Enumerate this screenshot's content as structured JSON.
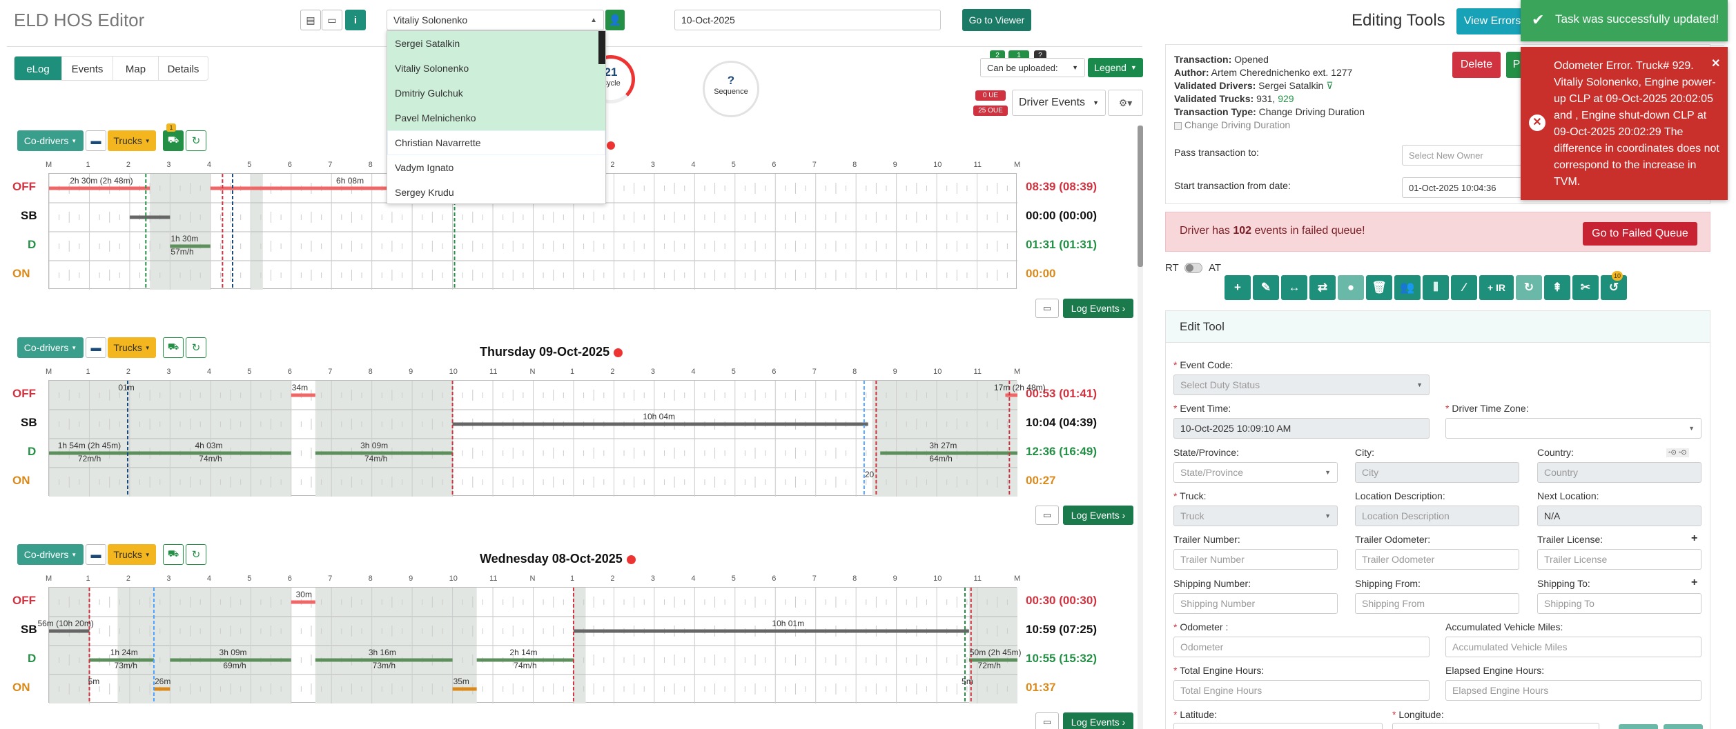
{
  "app": {
    "title": "ELD HOS Editor"
  },
  "header": {
    "driver_select": "Vitaliy Solonenko",
    "date": "10-Oct-2025",
    "go_viewer": "Go to Viewer"
  },
  "tabs": [
    {
      "label": "eLog"
    },
    {
      "label": "Events"
    },
    {
      "label": "Map"
    },
    {
      "label": "Details"
    }
  ],
  "dropdown": {
    "items": [
      "Sergei Satalkin",
      "Vitaliy Solonenko",
      "Dmitriy Gulchuk",
      "Pavel Melnichenko",
      "Christian Navarrette",
      "Vadym Ignato",
      "Sergey Krudu"
    ]
  },
  "circles": {
    "cycle_value": "21",
    "cycle_label": "Cycle",
    "seq_value": "?",
    "seq_label": "Sequence"
  },
  "upload": {
    "badge1": "2",
    "badge2": "1",
    "badge3": "?",
    "can_upload": "Can be uploaded:",
    "legend": "Legend",
    "ue": "0 UE",
    "oue": "25 OUE",
    "driver_events": "Driver Events"
  },
  "day_toolbar": {
    "codrivers": "Co-drivers",
    "trucks": "Trucks",
    "trucks_badge": "1",
    "log_events": "Log Events"
  },
  "hour_labels": [
    "M",
    "1",
    "2",
    "3",
    "4",
    "5",
    "6",
    "7",
    "8",
    "9",
    "10",
    "11",
    "N",
    "1",
    "2",
    "3",
    "4",
    "5",
    "6",
    "7",
    "8",
    "9",
    "10",
    "11",
    "M"
  ],
  "status_labels": {
    "off": "OFF",
    "sb": "SB",
    "d": "D",
    "on": "ON"
  },
  "days": [
    {
      "title": "",
      "totals": {
        "off": "08:39 (08:39)",
        "sb": "00:00 (00:00)",
        "d": "01:31 (01:31)",
        "on": "00:00"
      },
      "labels": {
        "l1": "2h 30m (2h 48m)",
        "l2": "6h 08m",
        "l3": "1h 30m",
        "l4": "57m/h"
      }
    },
    {
      "title": "Thursday 09-Oct-2025",
      "totals": {
        "off": "00:53 (01:41)",
        "sb": "10:04 (04:39)",
        "d": "12:36 (16:49)",
        "on": "00:27"
      },
      "labels": {
        "l1": "01m",
        "l2": "34m",
        "l3": "17m (2h 48m)",
        "l4": "10h 04m",
        "l5": "1h 54m (2h 45m)",
        "l6": "72m/h",
        "l7": "4h 03m",
        "l8": "74m/h",
        "l9": "3h 09m",
        "l10": "74m/h",
        "l11": "3h 27m",
        "l12": "64m/h",
        "l13": "20"
      }
    },
    {
      "title": "Wednesday 08-Oct-2025",
      "totals": {
        "off": "00:30 (00:30)",
        "sb": "10:59 (07:25)",
        "d": "10:55 (15:32)",
        "on": "01:37"
      },
      "labels": {
        "l1": "30m",
        "l2": "56m (10h 20m)",
        "l3": "10h 01m",
        "l4": "1h 24m",
        "l5": "73m/h",
        "l6": "3h 09m",
        "l7": "69m/h",
        "l8": "3h 16m",
        "l9": "73m/h",
        "l10": "2h 14m",
        "l11": "74m/h",
        "l12": "50m (2h 45m)",
        "l13": "72m/h",
        "l14": "5m",
        "l15": "26m",
        "l16": "35m",
        "l17": "5m"
      }
    }
  ],
  "editing": {
    "title": "Editing Tools",
    "view_errors": "View Errors",
    "transaction_label": "Transaction:",
    "transaction": "Opened",
    "author_label": "Author:",
    "author": "Artem Cherednichenko ext. 1277",
    "val_drivers_label": "Validated Drivers:",
    "val_drivers": "Sergei Satalkin",
    "val_trucks_label": "Validated Trucks:",
    "val_trucks_a": "931,",
    "val_trucks_b": "929",
    "ttype_label": "Transaction Type:",
    "ttype": "Change Driving Duration",
    "checkbox": "Change Driving Duration",
    "delete": "Delete",
    "p": "P",
    "pass_to": "Pass transaction to:",
    "owner_ph": "Select New Owner",
    "start_from": "Start transaction from date:",
    "start_date": "01-Oct-2025 10:04:36",
    "failed_pre": "Driver has ",
    "failed_num": "102",
    "failed_post": " events in failed queue!",
    "go_failed": "Go to Failed Queue",
    "rt": "RT",
    "at": "AT",
    "ir": "+ IR",
    "badge10": "10"
  },
  "edit_tool": {
    "title": "Edit Tool",
    "event_code": "Event Code:",
    "event_code_ph": "Select Duty Status",
    "event_time": "Event Time:",
    "event_time_val": "10-Oct-2025 10:09:10 AM",
    "driver_tz": "Driver Time Zone:",
    "state": "State/Province:",
    "state_ph": "State/Province",
    "city": "City:",
    "city_ph": "City",
    "country": "Country:",
    "country_ph": "Country",
    "truck": "Truck:",
    "truck_ph": "Truck",
    "loc_desc": "Location Description:",
    "loc_desc_ph": "Location Description",
    "next_loc": "Next Location:",
    "next_loc_val": "N/A",
    "trailer_num": "Trailer Number:",
    "trailer_num_ph": "Trailer Number",
    "trailer_odo": "Trailer Odometer:",
    "trailer_odo_ph": "Trailer Odometer",
    "trailer_lic": "Trailer License:",
    "trailer_lic_ph": "Trailer License",
    "ship_num": "Shipping Number:",
    "ship_num_ph": "Shipping Number",
    "ship_from": "Shipping From:",
    "ship_from_ph": "Shipping From",
    "ship_to": "Shipping To:",
    "ship_to_ph": "Shipping To",
    "odometer": "Odometer :",
    "odometer_ph": "Odometer",
    "acc_miles": "Accumulated Vehicle Miles:",
    "acc_miles_ph": "Accumulated Vehicle Miles",
    "eng_hours": "Total Engine Hours:",
    "eng_hours_ph": "Total Engine Hours",
    "elapsed": "Elapsed Engine Hours:",
    "elapsed_ph": "Elapsed Engine Hours",
    "lat": "Latitude:",
    "lon": "Longitude:"
  },
  "toasts": {
    "success": "Task was successfully updated!",
    "error": "Odometer Error. Truck# 929. Vitaliy Solonenko, Engine power-up CLP at 09-Oct-2025 20:02:05 and , Engine shut-down CLP at 09-Oct-2025 20:02:29 The difference in coordinates does not correspond to the increase in TVM."
  },
  "colors": {
    "teal": "#1e8f7a",
    "green": "#239046",
    "red": "#d0323f",
    "yellow": "#f3b61f",
    "cyan": "#17a2b8"
  }
}
